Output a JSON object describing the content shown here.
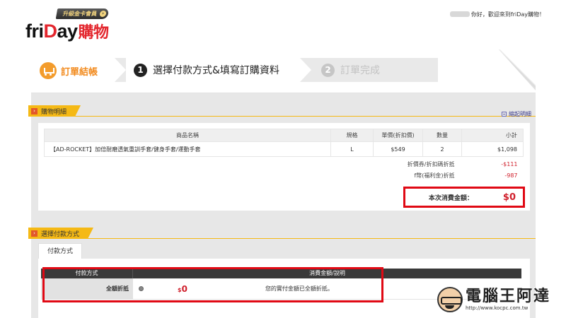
{
  "header": {
    "logo_part1": "fri",
    "logo_part2": "D",
    "logo_part3": "ay",
    "logo_part4": "購物",
    "upgrade_badge": "升級金卡會員",
    "upgrade_arrow": "›",
    "greeting": "你好，歡迎來到friDay購物！"
  },
  "steps": [
    {
      "label": "訂單結帳"
    },
    {
      "number": "1",
      "label": "選擇付款方式&填寫訂購資料"
    },
    {
      "number": "2",
      "label": "訂單完成"
    }
  ],
  "order_section": {
    "title": "購物明細",
    "collapse_label": "縮起明細",
    "columns": [
      "商品名稱",
      "規格",
      "單價(折扣價)",
      "數量",
      "小計"
    ],
    "rows": [
      {
        "name": "【AD-ROCKET】加倍耐磨透氣重訓手套/健身手套/運動手套",
        "spec": "L",
        "price": "$549",
        "qty": "2",
        "subtotal": "$1,098"
      }
    ],
    "discounts": [
      {
        "label": "折價券/折扣碼折抵",
        "value": "-$111"
      },
      {
        "label": "f幣(福利金)折抵",
        "value": "-987"
      }
    ],
    "total_label": "本次消費金額：",
    "total_value": "$0"
  },
  "payment_section": {
    "title": "選擇付款方式",
    "tab_label": "付款方式",
    "table_head": [
      "付款方式",
      "消費金額/說明"
    ],
    "row_label": "全額折抵",
    "amount_currency": "$",
    "amount_value": "0",
    "description": "您的實付金額已全額折抵。"
  },
  "watermark": {
    "title": "電腦王阿達",
    "url": "http://www.kocpc.com.tw"
  },
  "colors": {
    "accent_orange": "#f28b1f",
    "ribbon_yellow": "#f5b915",
    "price_red": "#d0202c",
    "highlight_red": "#e00914"
  }
}
